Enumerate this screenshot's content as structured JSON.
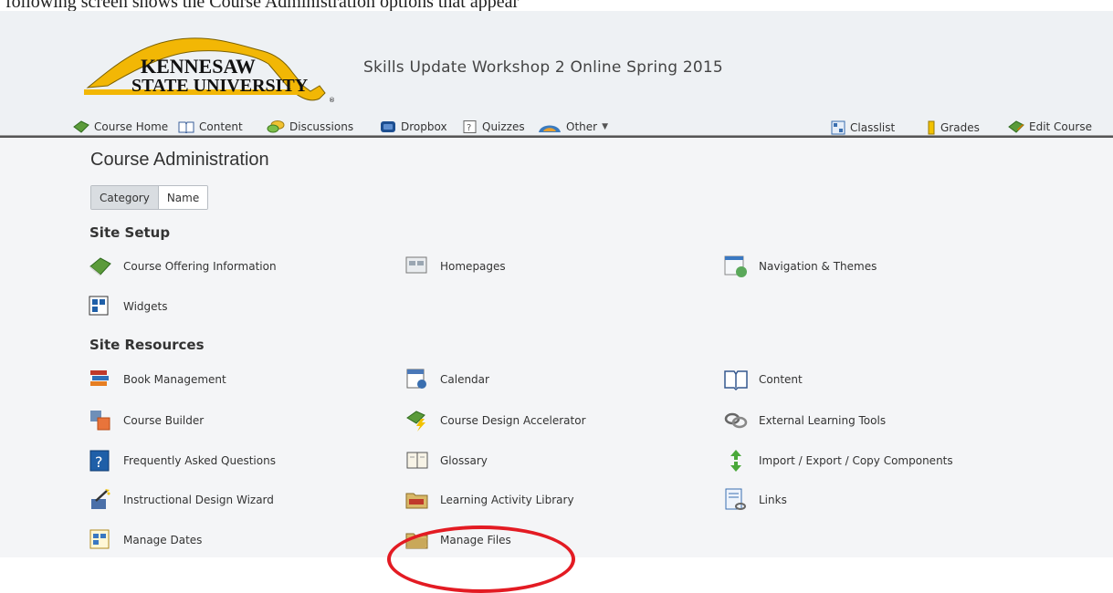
{
  "top_strip_text": "following screen shows the Course Administration options that appear",
  "logo": {
    "line1": "KENNESAW",
    "line2": "STATE UNIVERSITY",
    "mark": "®"
  },
  "course_title": "Skills Update Workshop 2 Online Spring 2015",
  "nav": {
    "left": [
      {
        "label": "Course Home",
        "icon": "book-icon"
      },
      {
        "label": "Content",
        "icon": "open-book-icon"
      },
      {
        "label": "Discussions",
        "icon": "speech-bubbles-icon"
      },
      {
        "label": "Dropbox",
        "icon": "dropbox-icon"
      },
      {
        "label": "Quizzes",
        "icon": "question-icon"
      },
      {
        "label": "Other",
        "icon": "dome-icon"
      }
    ],
    "right": [
      {
        "label": "Classlist",
        "icon": "classlist-icon"
      },
      {
        "label": "Grades",
        "icon": "ruler-icon"
      },
      {
        "label": "Edit Course",
        "icon": "edit-book-icon"
      }
    ]
  },
  "page_title": "Course Administration",
  "view_toggle": {
    "category": "Category",
    "name": "Name"
  },
  "sections": {
    "site_setup": {
      "title": "Site Setup",
      "tools": [
        {
          "label": "Course Offering Information",
          "icon": "book-icon"
        },
        {
          "label": "Homepages",
          "icon": "homepage-icon"
        },
        {
          "label": "Navigation & Themes",
          "icon": "navigation-icon"
        },
        {
          "label": "Widgets",
          "icon": "widgets-icon"
        }
      ]
    },
    "site_resources": {
      "title": "Site Resources",
      "tools": [
        {
          "label": "Book Management",
          "icon": "books-stack-icon"
        },
        {
          "label": "Calendar",
          "icon": "calendar-icon"
        },
        {
          "label": "Content",
          "icon": "open-book-icon"
        },
        {
          "label": "Course Builder",
          "icon": "course-builder-icon"
        },
        {
          "label": "Course Design Accelerator",
          "icon": "accelerator-icon"
        },
        {
          "label": "External Learning Tools",
          "icon": "chain-link-icon"
        },
        {
          "label": "Frequently Asked Questions",
          "icon": "faq-icon"
        },
        {
          "label": "Glossary",
          "icon": "glossary-icon"
        },
        {
          "label": "Import / Export / Copy Components",
          "icon": "import-export-icon"
        },
        {
          "label": "Instructional Design Wizard",
          "icon": "wizard-icon"
        },
        {
          "label": "Learning Activity Library",
          "icon": "folder-icon"
        },
        {
          "label": "Links",
          "icon": "links-icon"
        },
        {
          "label": "Manage Dates",
          "icon": "manage-dates-icon"
        },
        {
          "label": "Manage Files",
          "icon": "folder-icon"
        }
      ]
    }
  },
  "colors": {
    "header_bg": "#eef1f4",
    "main_bg": "#f4f5f7",
    "annotation_circle": "#e31b23",
    "ksu_gold": "#f2b705"
  }
}
